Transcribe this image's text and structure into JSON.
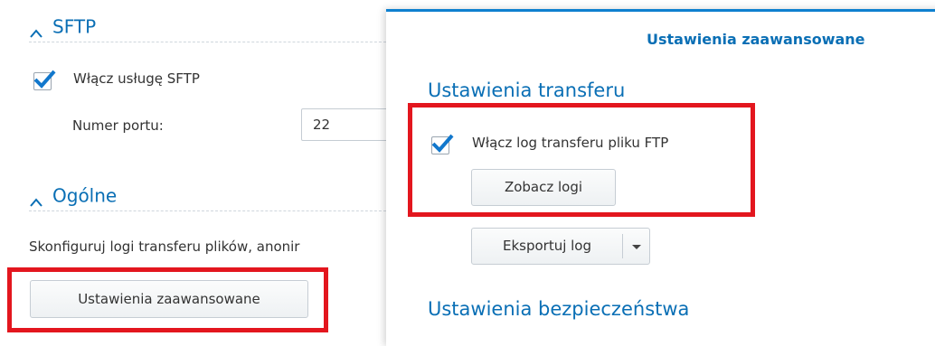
{
  "settings": {
    "sftp_section": {
      "title": "SFTP",
      "enable_label": "Włącz usługę SFTP",
      "enabled": true
    },
    "port": {
      "label": "Numer portu:",
      "value": "22"
    },
    "general_section": {
      "title": "Ogólne",
      "description": "Skonfiguruj logi transferu plików, anonir",
      "advanced_button": "Ustawienia zaawansowane"
    }
  },
  "dialog": {
    "title": "Ustawienia zaawansowane",
    "transfer_section": {
      "title": "Ustawienia transferu",
      "enable_log_label": "Włącz log transferu pliku FTP",
      "enable_log_checked": true,
      "view_logs_button": "Zobacz logi",
      "export_log_button": "Eksportuj log"
    },
    "security_section": {
      "title": "Ustawienia bezpieczeństwa"
    }
  },
  "colors": {
    "accent": "#0a6fb5",
    "checkbox_check": "#1177cc",
    "highlight": "#e3161e"
  }
}
